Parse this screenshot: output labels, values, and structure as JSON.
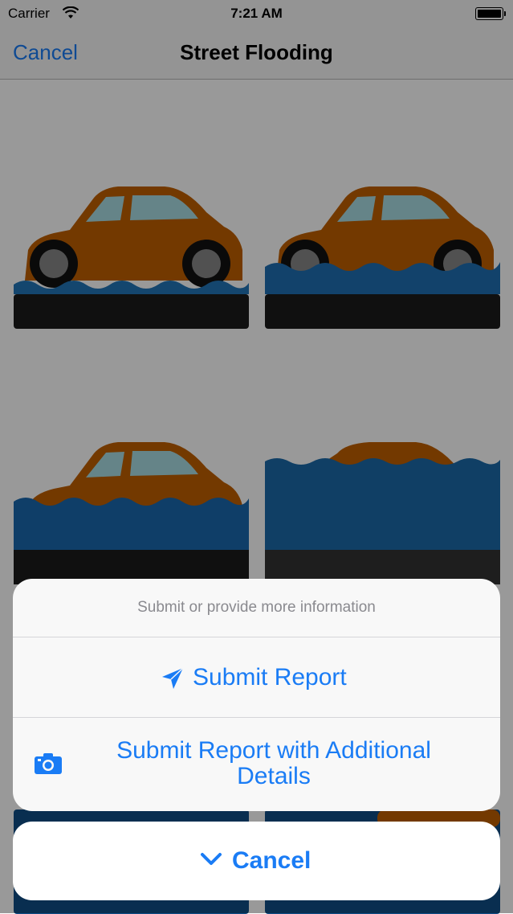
{
  "status_bar": {
    "carrier": "Carrier",
    "time": "7:21 AM"
  },
  "nav": {
    "cancel_label": "Cancel",
    "title": "Street Flooding"
  },
  "grid": {
    "items": [
      {
        "name": "car-flood-level-1",
        "water_level": 0.2
      },
      {
        "name": "car-flood-level-2",
        "water_level": 0.4
      },
      {
        "name": "car-flood-level-3",
        "water_level": 0.6
      },
      {
        "name": "car-flood-level-4",
        "water_level": 0.9
      }
    ]
  },
  "action_sheet": {
    "message": "Submit or provide more information",
    "submit_label": "Submit Report",
    "submit_icon": "paper-plane-icon",
    "details_label": "Submit Report with Additional Details",
    "details_icon": "camera-icon",
    "cancel_label": "Cancel",
    "cancel_icon": "chevron-down-icon"
  },
  "colors": {
    "accent": "#1a7cf5",
    "car": "#c05f00",
    "water": "#1b6fb5"
  }
}
